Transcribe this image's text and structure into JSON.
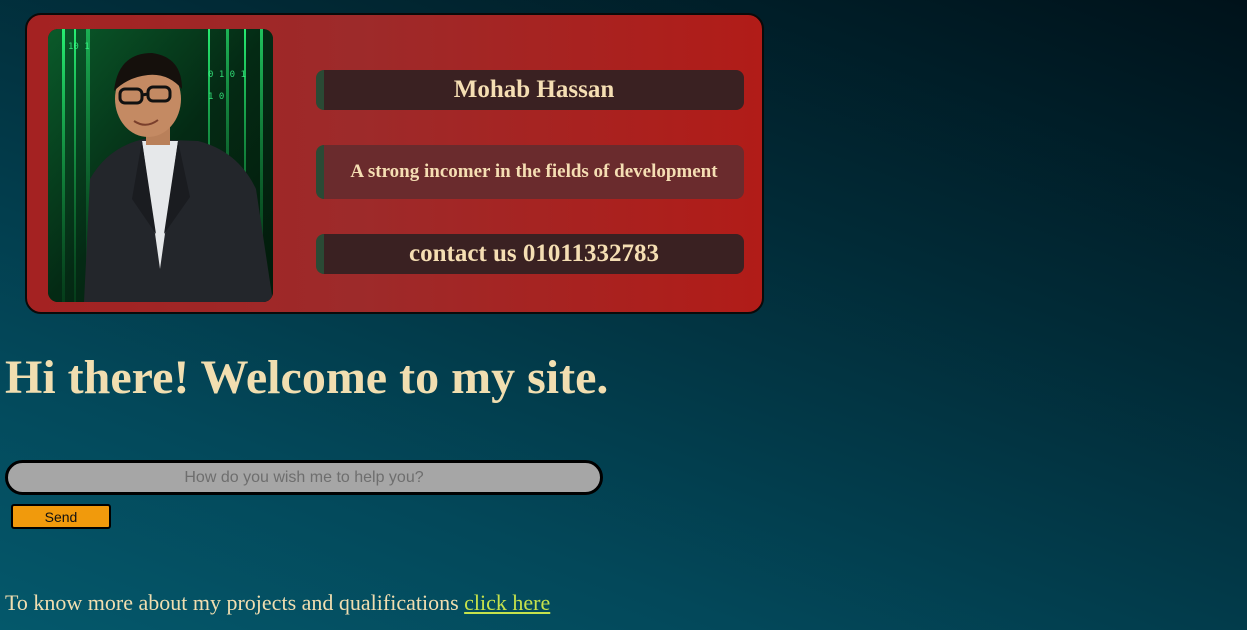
{
  "profile": {
    "name": "Mohab Hassan",
    "tagline": "A strong incomer in the fields of development",
    "contact": "contact us 01011332783",
    "photo_icon": "profile-photo"
  },
  "welcome": {
    "heading": "Hi there! Welcome to my site."
  },
  "help_form": {
    "placeholder": "How do you wish me to help you?",
    "value": "",
    "send_label": "Send"
  },
  "more_info": {
    "text": "To know more about my projects and qualifications ",
    "link_label": "click here"
  },
  "colors": {
    "card_bg": "#a42222",
    "text_cream": "#f1deb0",
    "send_button": "#f19a0c",
    "link": "#c6e24c"
  }
}
